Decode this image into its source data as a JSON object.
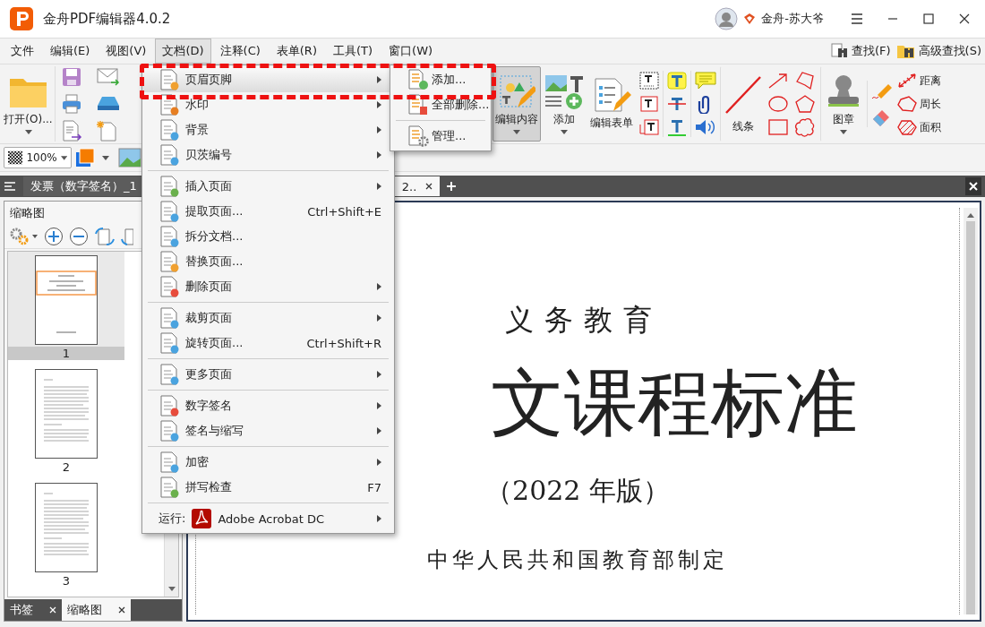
{
  "window": {
    "title": "金舟PDF编辑器4.0.2",
    "user": "金舟-苏大爷"
  },
  "menubar": [
    {
      "label": "文件",
      "selected": false
    },
    {
      "label": "编辑(E)",
      "selected": false
    },
    {
      "label": "视图(V)",
      "selected": false
    },
    {
      "label": "文档(D)",
      "selected": true
    },
    {
      "label": "注释(C)",
      "selected": false
    },
    {
      "label": "表单(R)",
      "selected": false
    },
    {
      "label": "工具(T)",
      "selected": false
    },
    {
      "label": "窗口(W)",
      "selected": false
    }
  ],
  "find": [
    "查找(F)",
    "高级查找(S)"
  ],
  "ribbon": {
    "open": "打开(O)...",
    "big_buttons": [
      {
        "label": "编辑内容",
        "selected": true,
        "dropdown": true
      },
      {
        "label": "添加",
        "selected": false,
        "dropdown": true
      },
      {
        "label": "编辑表单",
        "selected": false,
        "dropdown": false
      }
    ],
    "lines": "线条",
    "stamp": "图章",
    "measure": [
      "距离",
      "周长",
      "面积"
    ]
  },
  "zoom": {
    "value": "100%"
  },
  "doc_tabs": [
    {
      "label": "发票（数字签名）_1",
      "selected": false
    },
    {
      "label": "2..",
      "selected": true
    }
  ],
  "side_panel": {
    "title": "缩略图",
    "thumbnails": [
      {
        "label": "1",
        "selected": true
      },
      {
        "label": "2",
        "selected": false
      },
      {
        "label": "3",
        "selected": false
      }
    ],
    "tabs": [
      {
        "label": "书签",
        "selected": false
      },
      {
        "label": "缩略图",
        "selected": true
      }
    ]
  },
  "page": {
    "subtitle": "义务教育",
    "title": "文课程标准",
    "edition": "（2022 年版）",
    "publisher": "中华人民共和国教育部制定"
  },
  "menu": {
    "groups": [
      [
        {
          "kind": "item",
          "label": "页眉页脚",
          "has_submenu": true,
          "selected": true
        },
        {
          "kind": "item",
          "label": "水印",
          "has_submenu": true,
          "selected": false
        },
        {
          "kind": "item",
          "label": "背景",
          "has_submenu": true,
          "selected": false
        },
        {
          "kind": "item",
          "label": "贝茨编号",
          "has_submenu": true,
          "selected": false
        }
      ],
      [
        {
          "kind": "item",
          "label": "插入页面",
          "has_submenu": true,
          "selected": false
        },
        {
          "kind": "item",
          "label": "提取页面...",
          "shortcut": "Ctrl+Shift+E",
          "has_submenu": false,
          "selected": false
        },
        {
          "kind": "item",
          "label": "拆分文档...",
          "has_submenu": false,
          "selected": false
        },
        {
          "kind": "item",
          "label": "替换页面...",
          "has_submenu": false,
          "selected": false
        },
        {
          "kind": "item",
          "label": "删除页面",
          "has_submenu": true,
          "selected": false
        }
      ],
      [
        {
          "kind": "item",
          "label": "裁剪页面",
          "has_submenu": true,
          "selected": false
        },
        {
          "kind": "item",
          "label": "旋转页面...",
          "shortcut": "Ctrl+Shift+R",
          "has_submenu": false,
          "selected": false
        }
      ],
      [
        {
          "kind": "item",
          "label": "更多页面",
          "has_submenu": true,
          "selected": false
        }
      ],
      [
        {
          "kind": "item",
          "label": "数字签名",
          "has_submenu": true,
          "selected": false
        },
        {
          "kind": "item",
          "label": "签名与缩写",
          "has_submenu": true,
          "selected": false
        }
      ],
      [
        {
          "kind": "item",
          "label": "加密",
          "has_submenu": true,
          "selected": false
        },
        {
          "kind": "item",
          "label": "拼写检查",
          "shortcut": "F7",
          "has_submenu": false,
          "selected": false
        }
      ],
      [
        {
          "kind": "run",
          "label": "运行:",
          "app": "Adobe Acrobat DC",
          "has_submenu": true,
          "selected": false
        }
      ]
    ]
  },
  "submenu": {
    "groups": [
      [
        {
          "label": "添加...",
          "selected": false
        },
        {
          "label": "全部删除...",
          "selected": false
        }
      ],
      [
        {
          "label": "管理...",
          "selected": false
        }
      ]
    ]
  }
}
